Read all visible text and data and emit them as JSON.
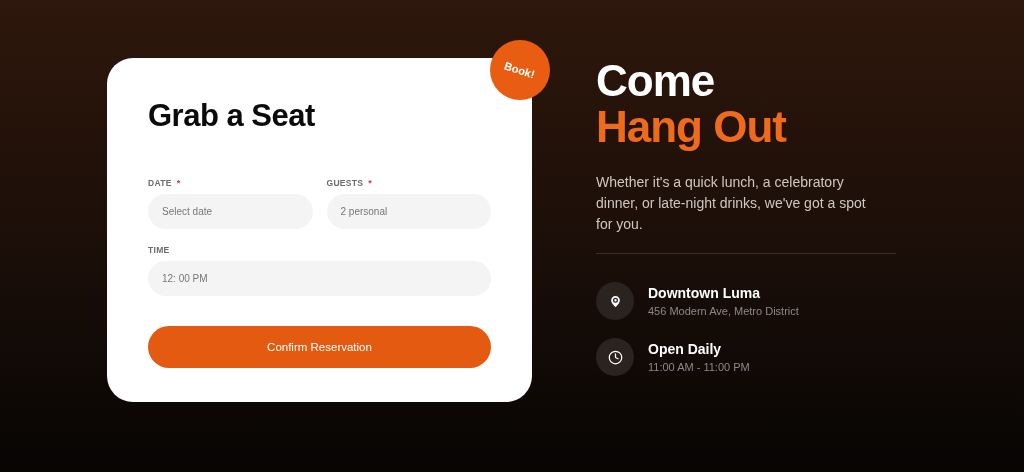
{
  "card": {
    "title": "Grab a Seat",
    "badge": "Book!",
    "fields": [
      {
        "label": "DATE",
        "required_mark": "*",
        "placeholder": "Select date",
        "kind": "half"
      },
      {
        "label": "GUESTS",
        "required_mark": "*",
        "placeholder": "2 personal",
        "kind": "half"
      },
      {
        "label": "TIME",
        "placeholder": "12: 00 PM",
        "kind": "full"
      }
    ],
    "button": "Confirm Reservation"
  },
  "info": {
    "heading_line_1": "Come",
    "heading_line_2": "Hang Out",
    "description": "Whether it's a quick lunch, a celebratory dinner, or late-night drinks, we've got a spot for you.",
    "items": [
      {
        "kind": "location",
        "title": "Downtown Luma",
        "detail": "456 Modern Ave, Metro District"
      },
      {
        "kind": "hours",
        "title": "Open Daily",
        "detail": "11:00 AM - 11:00 PM"
      }
    ]
  }
}
